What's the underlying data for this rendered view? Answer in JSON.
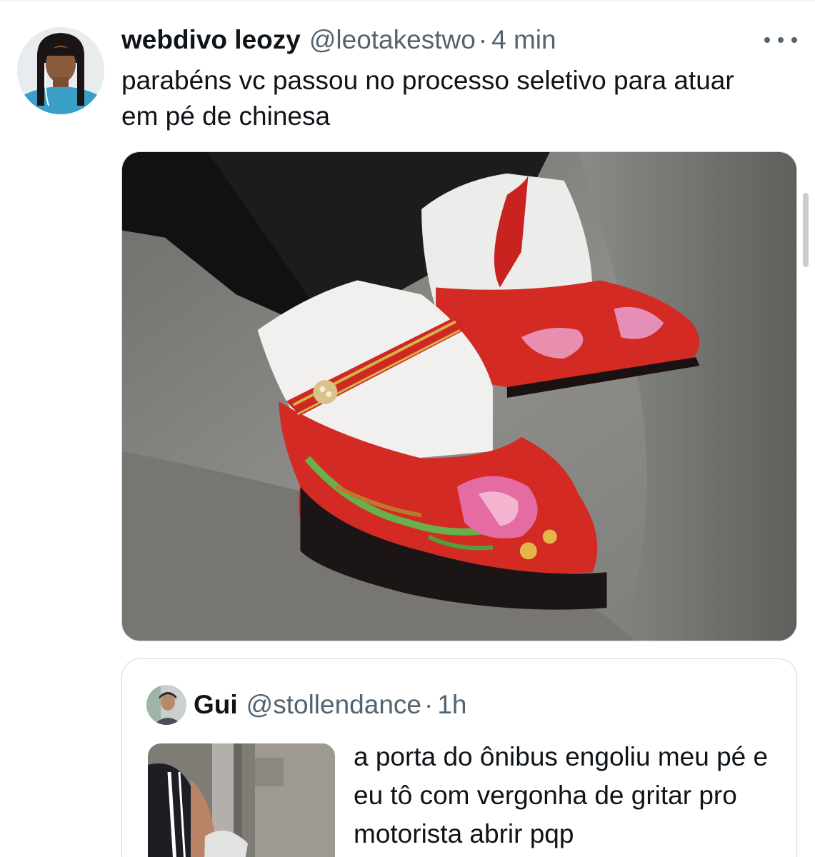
{
  "tweet": {
    "author_name": "webdivo leozy",
    "author_handle": "@leotakestwo",
    "separator": "·",
    "time": "4 min",
    "text": "parabéns vc passou no processo seletivo para atuar em pé de chinesa",
    "more_icon": "more-horizontal-icon"
  },
  "quoted": {
    "author_name": "Gui",
    "author_handle": "@stollendance",
    "separator": "·",
    "time": "1h",
    "text": "a porta do ônibus engoliu meu pé e eu tô com vergonha de gritar pro motorista abrir pqp"
  },
  "colors": {
    "text": "#0f1419",
    "secondary": "#536471",
    "border": "#cfd9de",
    "shoe_red": "#d42a24"
  }
}
